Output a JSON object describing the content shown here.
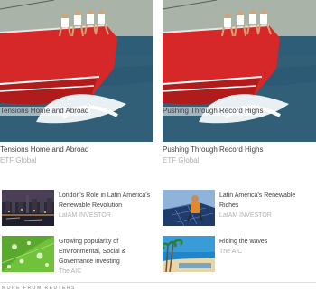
{
  "features": [
    {
      "title": "Tensions Home and Abroad",
      "overlay": "Tensions Home and Abroad",
      "source": "ETF Global"
    },
    {
      "title": "Pushing Through Record Highs",
      "overlay": "Pushing Through Record Highs",
      "source": "ETF Global"
    }
  ],
  "items": [
    {
      "title": "London's Role in Latin America's Renewable Revolution",
      "source": "LatAM INVESTOR",
      "image": "city-night-skyline"
    },
    {
      "title": "Latin America's Renewable Riches",
      "source": "LatAM INVESTOR",
      "image": "solar-panel-worker"
    },
    {
      "title": "Growing popularity of Environmental, Social & Governance investing",
      "source": "The AIC",
      "image": "green-leaf-droplets"
    },
    {
      "title": "Riding the waves",
      "source": "The AIC",
      "image": "beach-palm-trees"
    }
  ],
  "footer": {
    "label": "MORE FROM REUTERS"
  },
  "colors": {
    "hull": "#d62828",
    "sea": "#2d5d77",
    "source": "#b0b0b0"
  }
}
